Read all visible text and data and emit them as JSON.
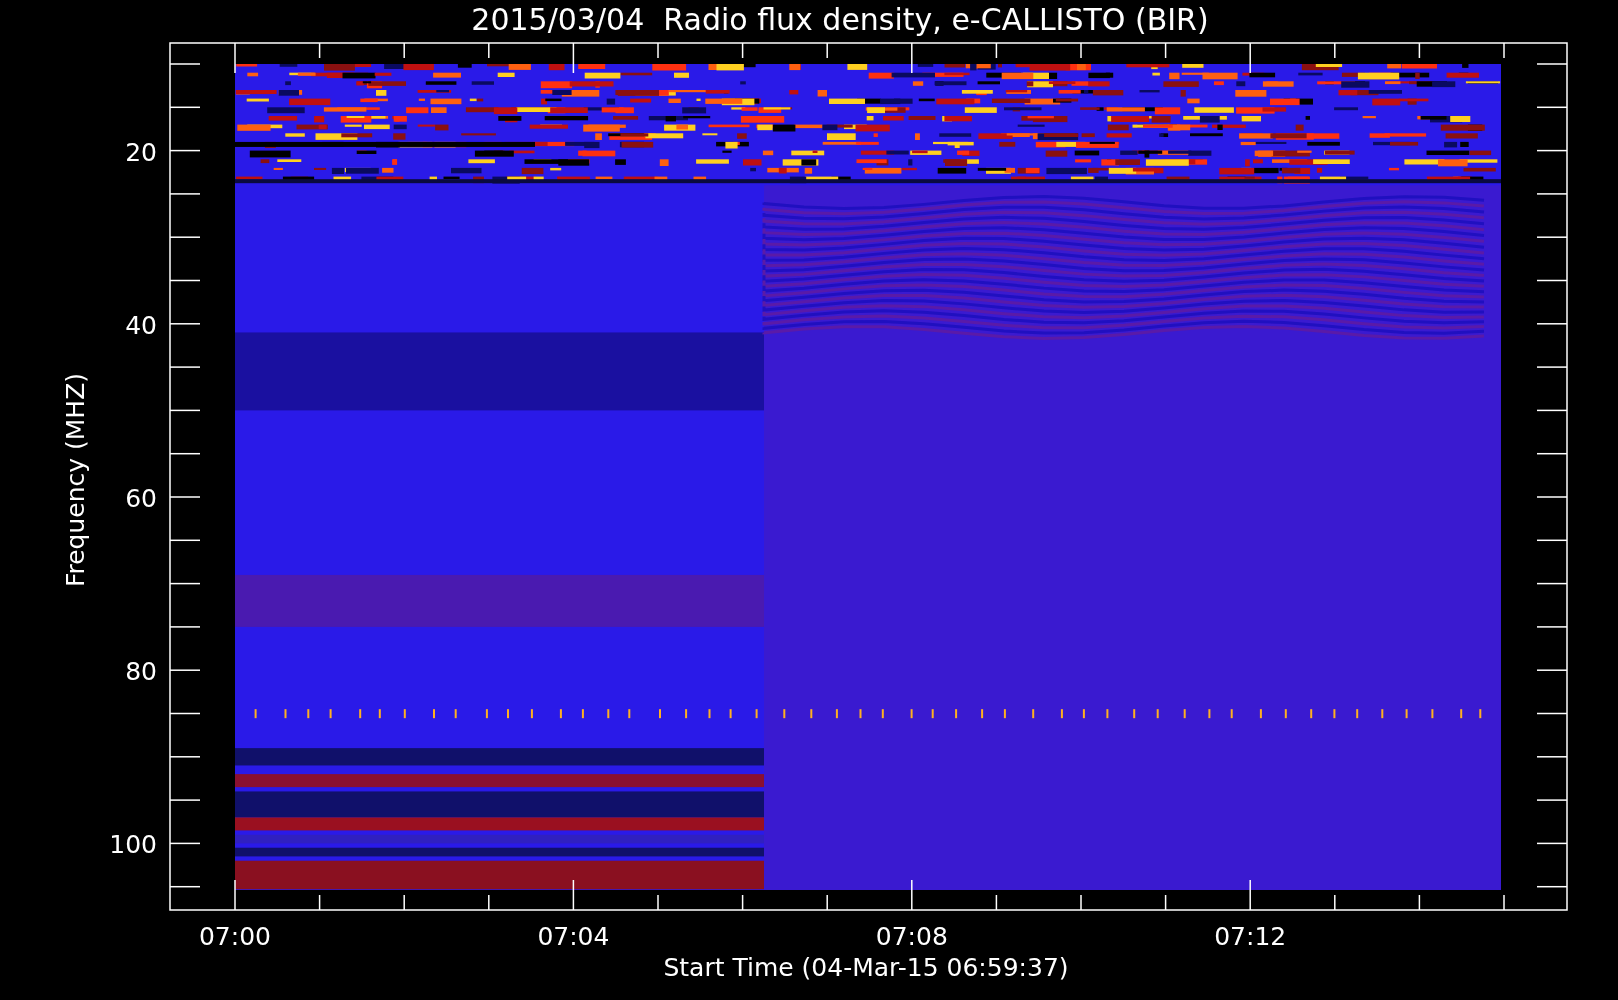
{
  "title": "2015/03/04  Radio flux density, e-CALLISTO (BIR)",
  "plot": {
    "ylabel": "Frequency (MHZ)",
    "xlabel": "Start Time (04-Mar-15 06:59:37)",
    "y_tick_labels": [
      "20",
      "40",
      "60",
      "80",
      "100"
    ],
    "x_tick_labels": [
      "07:00",
      "07:04",
      "07:08",
      "07:12"
    ]
  }
}
